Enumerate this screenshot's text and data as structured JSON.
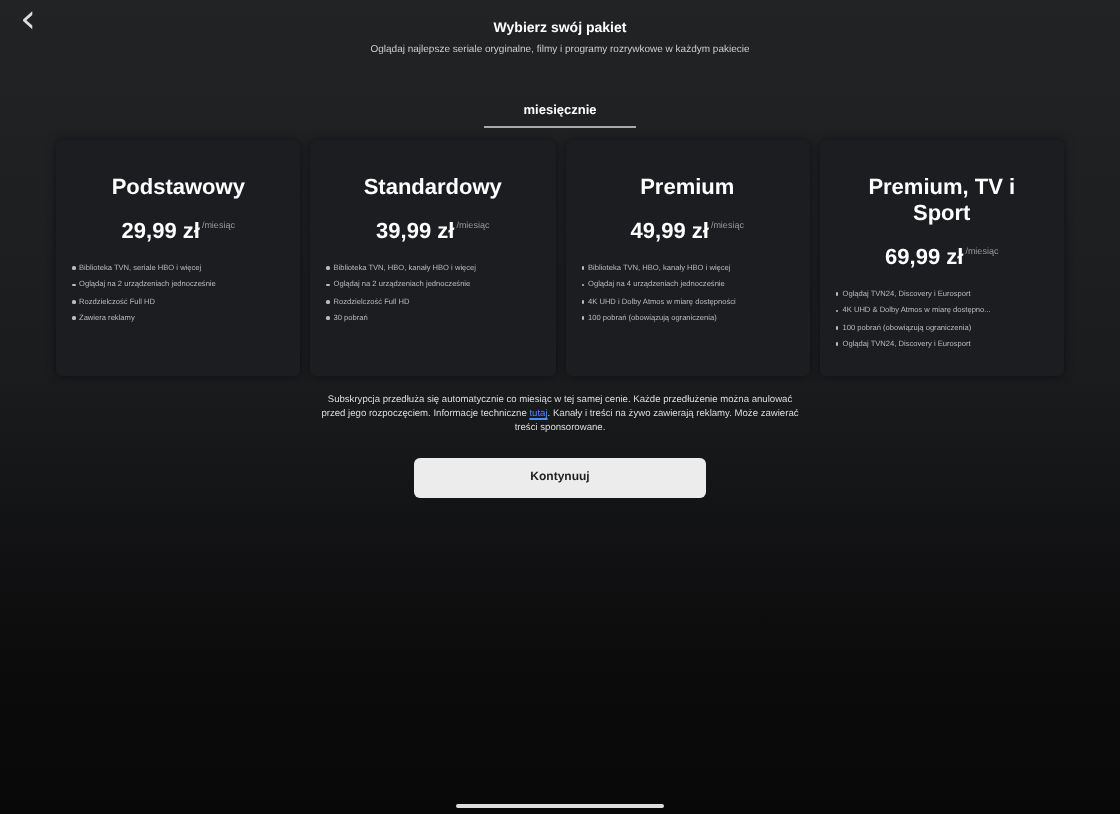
{
  "header": {
    "back": "‹",
    "title": "Wybierz swój pakiet",
    "subtitle": "Oglądaj najlepsze seriale oryginalne, filmy i programy rozrywkowe w każdym pakiecie"
  },
  "tabs": [
    {
      "label": "miesięcznie",
      "selected": true
    }
  ],
  "plans": [
    {
      "name": "Podstawowy",
      "price": "29,99 zł",
      "period": "/miesiąc",
      "features": [
        "Biblioteka TVN, seriale HBO i więcej",
        "Oglądaj na 2 urządzeniach jednocześnie",
        "Rozdzielczość Full HD",
        "Zawiera reklamy"
      ]
    },
    {
      "name": "Standardowy",
      "price": "39,99 zł",
      "period": "/miesiąc",
      "features": [
        "Biblioteka TVN, HBO, kanały HBO i więcej",
        "Oglądaj na 2 urządzeniach jednocześnie",
        "Rozdzielczość Full HD",
        "30 pobrań"
      ]
    },
    {
      "name": "Premium",
      "price": "49,99 zł",
      "period": "/miesiąc",
      "features": [
        "Biblioteka TVN, HBO, kanały HBO i więcej",
        "Oglądaj na 4 urządzeniach jednocześnie",
        "4K UHD i Dolby Atmos w miarę dostępności",
        "100 pobrań (obowiązują ograniczenia)"
      ]
    },
    {
      "name": "Premium, TV i Sport",
      "price": "69,99 zł",
      "period": "/miesiąc",
      "features": [
        "Oglądaj TVN24, Discovery i Eurosport",
        "4K UHD & Dolby Atmos w miarę dostępno...",
        "100 pobrań (obowiązują ograniczenia)",
        "Oglądaj TVN24, Discovery i Eurosport"
      ]
    }
  ],
  "notice": {
    "before": "Subskrypcja przedłuża się automatycznie co miesiąc w tej samej cenie. Każde przedłużenie można anulować przed jego rozpoczęciem. Informacje techniczne",
    "link": "tutaj",
    "after": ". Kanały i treści na żywo zawierają reklamy. Może zawierać treści sponsorowane."
  },
  "button": "Kontynuuj"
}
